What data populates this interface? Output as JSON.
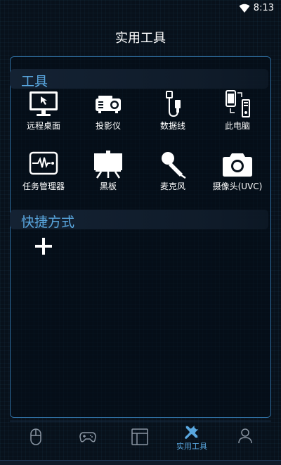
{
  "status": {
    "time": "8:13"
  },
  "header": {
    "title": "实用工具"
  },
  "sections": {
    "tools_title": "工具",
    "shortcuts_title": "快捷方式"
  },
  "tools": [
    {
      "label": "远程桌面",
      "icon": "monitor-icon"
    },
    {
      "label": "投影仪",
      "icon": "projector-icon"
    },
    {
      "label": "数据线",
      "icon": "usb-cable-icon"
    },
    {
      "label": "此电脑",
      "icon": "devices-icon"
    },
    {
      "label": "任务管理器",
      "icon": "pulse-monitor-icon"
    },
    {
      "label": "黑板",
      "icon": "blackboard-icon"
    },
    {
      "label": "麦克风",
      "icon": "microphone-icon"
    },
    {
      "label": "摄像头(UVC)",
      "icon": "camera-icon"
    }
  ],
  "nav": {
    "items": [
      "mouse-icon",
      "gamepad-icon",
      "layout-icon",
      "tools-icon",
      "user-icon"
    ],
    "active_label": "实用工具"
  },
  "colors": {
    "accent": "#5aa8e0",
    "background": "#08111b",
    "panel_border": "#2f6ea0"
  }
}
